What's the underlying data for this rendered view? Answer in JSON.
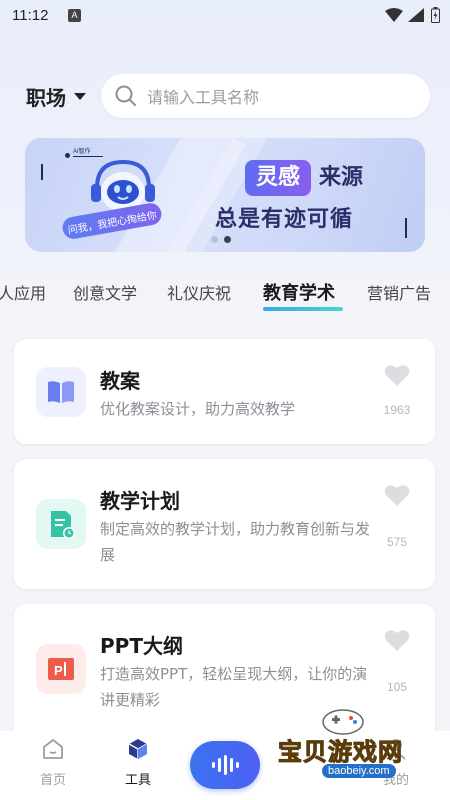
{
  "status_bar": {
    "time": "11:12",
    "notification_icon": "A"
  },
  "header": {
    "category": "职场",
    "search_placeholder": "请输入工具名称"
  },
  "banner": {
    "tagline": "AI智作",
    "bubble": "问我，我把心掏给你",
    "highlight": "灵感",
    "headline_rest": "来源",
    "subline": "总是有迹可循",
    "pages": 2,
    "active_page": 2
  },
  "tabs": [
    {
      "label": "人应用"
    },
    {
      "label": "创意文学"
    },
    {
      "label": "礼仪庆祝"
    },
    {
      "label": "教育学术",
      "active": true
    },
    {
      "label": "营销广告"
    }
  ],
  "tools": [
    {
      "title": "教案",
      "desc": "优化教案设计，助力高效教学",
      "count": "1963",
      "icon": "book-icon",
      "icon_bg": "#eef0fd",
      "icon_color": "#6b7cf0"
    },
    {
      "title": "教学计划",
      "desc": "制定高效的教学计划，助力教育创新与发展",
      "count": "575",
      "icon": "plan-doc-icon",
      "icon_bg": "#e3f7f3",
      "icon_color": "#35c2a6"
    },
    {
      "title": "PPT大纲",
      "desc": "打造高效PPT，轻松呈现大纲，让你的演讲更精彩",
      "count": "105",
      "icon": "ppt-icon",
      "icon_bg": "#fdecea",
      "icon_color": "#ef5b4b"
    }
  ],
  "bottom_nav": {
    "home": "首页",
    "tools": "工具",
    "mine": "我的"
  },
  "watermark": {
    "text": "宝贝游戏网",
    "url": "baobeiy.com"
  },
  "colors": {
    "accent": "#3b73f0",
    "tab_underline": "#3fc3d6"
  }
}
